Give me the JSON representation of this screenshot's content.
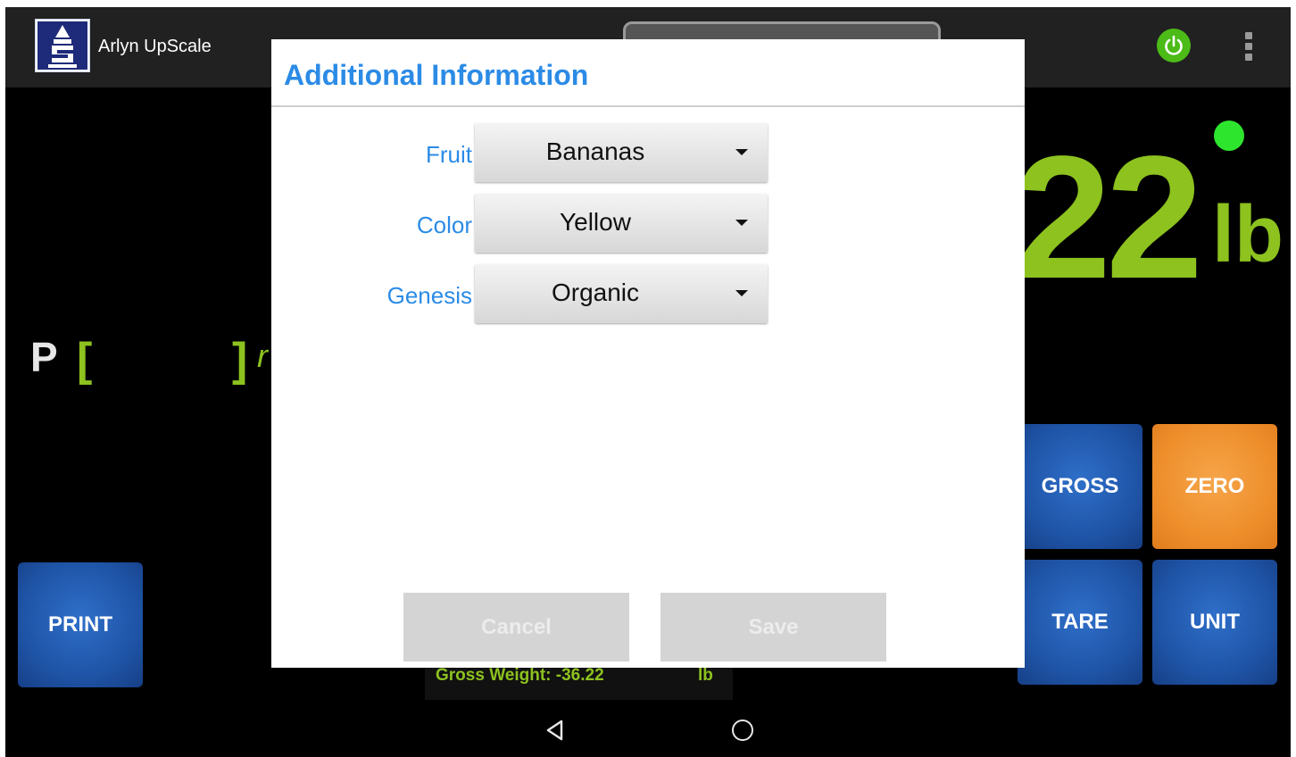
{
  "app": {
    "title": "Arlyn UpScale"
  },
  "scale": {
    "weight_display": "22",
    "unit": "lb",
    "plu_prefix": "P",
    "plu_open": "[",
    "plu_close": "]",
    "plu_suffix": "r"
  },
  "keys": {
    "print": "PRINT",
    "gross": "GROSS",
    "zero": "ZERO",
    "tare": "TARE",
    "unit": "UNIT"
  },
  "status_bar": {
    "gross_label": "Gross Weight:  -36.22",
    "gross_unit": "lb"
  },
  "dialog": {
    "title": "Additional Information",
    "fields": [
      {
        "label": "Fruit",
        "value": "Bananas"
      },
      {
        "label": "Color",
        "value": "Yellow"
      },
      {
        "label": "Genesis",
        "value": "Organic"
      }
    ],
    "cancel_label": "Cancel",
    "save_label": "Save"
  },
  "icons": {
    "power": "power-icon",
    "overflow": "more-vert-icon",
    "back": "nav-back-icon",
    "home": "nav-home-icon"
  },
  "colors": {
    "accent_blue": "#2b8be6",
    "weight_green": "#8dc21f",
    "key_blue": "#1f55a8",
    "key_orange": "#ee8f2c",
    "status_dot": "#2ee52e"
  }
}
